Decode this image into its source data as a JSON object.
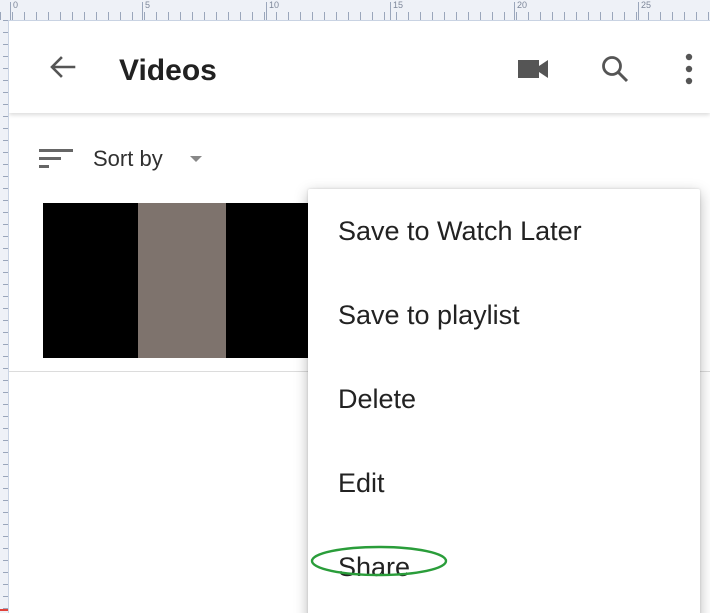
{
  "header": {
    "back_icon": "arrow-back-icon",
    "title": "Videos",
    "camera_icon": "videocam-icon",
    "search_icon": "search-icon",
    "more_icon": "more-vert-icon"
  },
  "sort": {
    "icon": "sort-icon",
    "label": "Sort by",
    "caret_icon": "dropdown-caret-icon"
  },
  "ruler": {
    "labels": [
      "0",
      "5",
      "10",
      "15",
      "20",
      "25"
    ]
  },
  "menu": {
    "items": [
      {
        "label": "Save to Watch Later"
      },
      {
        "label": "Save to playlist"
      },
      {
        "label": "Delete"
      },
      {
        "label": "Edit"
      },
      {
        "label": "Share"
      }
    ],
    "highlight_color": "#2a9d3a"
  },
  "colors": {
    "thumbnail_bg": "#000000",
    "thumbnail_stripe": "#7e736d",
    "icon": "#555555",
    "title_text": "#212121"
  }
}
